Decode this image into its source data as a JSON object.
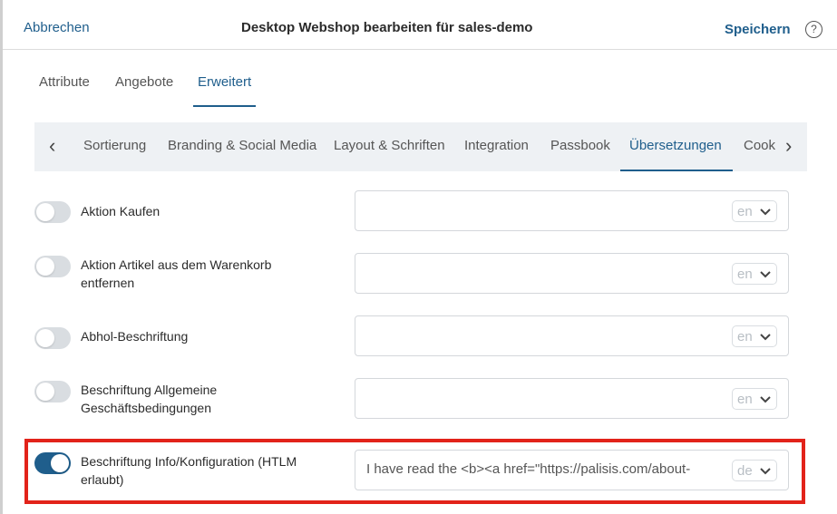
{
  "header": {
    "cancel_label": "Abbrechen",
    "title": "Desktop Webshop bearbeiten für sales-demo",
    "save_label": "Speichern",
    "help_glyph": "?"
  },
  "tabs": [
    "Attribute",
    "Angebote",
    "Erweitert"
  ],
  "active_tab": "Erweitert",
  "subnav": {
    "items": [
      "Sortierung",
      "Branding & Social Media",
      "Layout & Schriften",
      "Integration",
      "Passbook",
      "Übersetzungen",
      "Cookie"
    ],
    "active": "Übersetzungen",
    "left_arrow": "‹",
    "right_arrow": "›"
  },
  "rows": [
    {
      "label": "Aktion Kaufen",
      "enabled": false,
      "value": "",
      "lang": "en"
    },
    {
      "label": "Aktion Artikel aus dem Warenkorb entfernen",
      "enabled": false,
      "value": "",
      "lang": "en"
    },
    {
      "label": "Abhol-Beschriftung",
      "enabled": false,
      "value": "",
      "lang": "en"
    },
    {
      "label": "Beschriftung Allgemeine Geschäftsbedingungen",
      "enabled": false,
      "value": "",
      "lang": "en"
    },
    {
      "label": "Beschriftung Info/Konfiguration (HTLM erlaubt)",
      "enabled": true,
      "value": "I have read the <b><a href=\"https://palisis.com/about-",
      "lang": "de"
    }
  ],
  "colors": {
    "accent": "#1f5e8c",
    "highlight": "#e2231a",
    "toggle_off": "#d9dde1",
    "subnav_bg": "#eef1f4"
  },
  "icons": {
    "help": "help-circle-icon",
    "prev": "chevron-left-icon",
    "next": "chevron-right-icon",
    "dropdown": "chevron-down-icon"
  }
}
